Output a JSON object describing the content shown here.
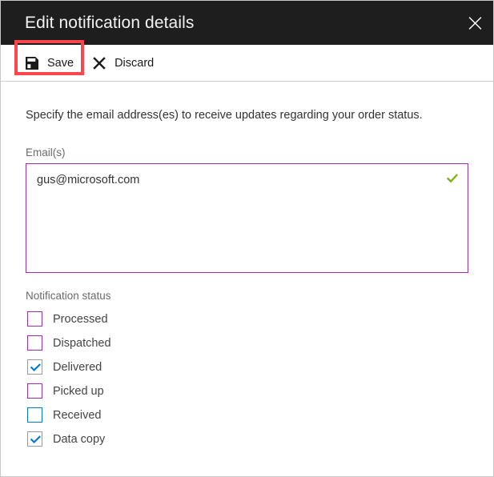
{
  "window": {
    "title": "Edit notification details",
    "close_icon": "close-icon",
    "accent_purple": "#9b2fae",
    "accent_blue": "#0078d7",
    "valid_green": "#7ab317",
    "highlight_red": "#f9474d",
    "header_bg": "#1e1e1e"
  },
  "toolbar": {
    "save_label": "Save",
    "save_icon": "save-floppy-icon",
    "discard_label": "Discard",
    "discard_icon": "close-x-icon"
  },
  "form": {
    "description": "Specify the email address(es) to receive updates regarding your order status.",
    "email_field": {
      "label": "Email(s)",
      "value": "gus@microsoft.com",
      "placeholder": "",
      "valid_icon": "checkmark-icon",
      "state": "focused"
    },
    "notification_status": {
      "label": "Notification status",
      "items": [
        {
          "label": "Processed",
          "checked": false,
          "state": "normal"
        },
        {
          "label": "Dispatched",
          "checked": false,
          "state": "normal"
        },
        {
          "label": "Delivered",
          "checked": true,
          "state": "checked"
        },
        {
          "label": "Picked up",
          "checked": false,
          "state": "normal"
        },
        {
          "label": "Received",
          "checked": false,
          "state": "focus"
        },
        {
          "label": "Data copy",
          "checked": true,
          "state": "checked"
        }
      ]
    }
  }
}
